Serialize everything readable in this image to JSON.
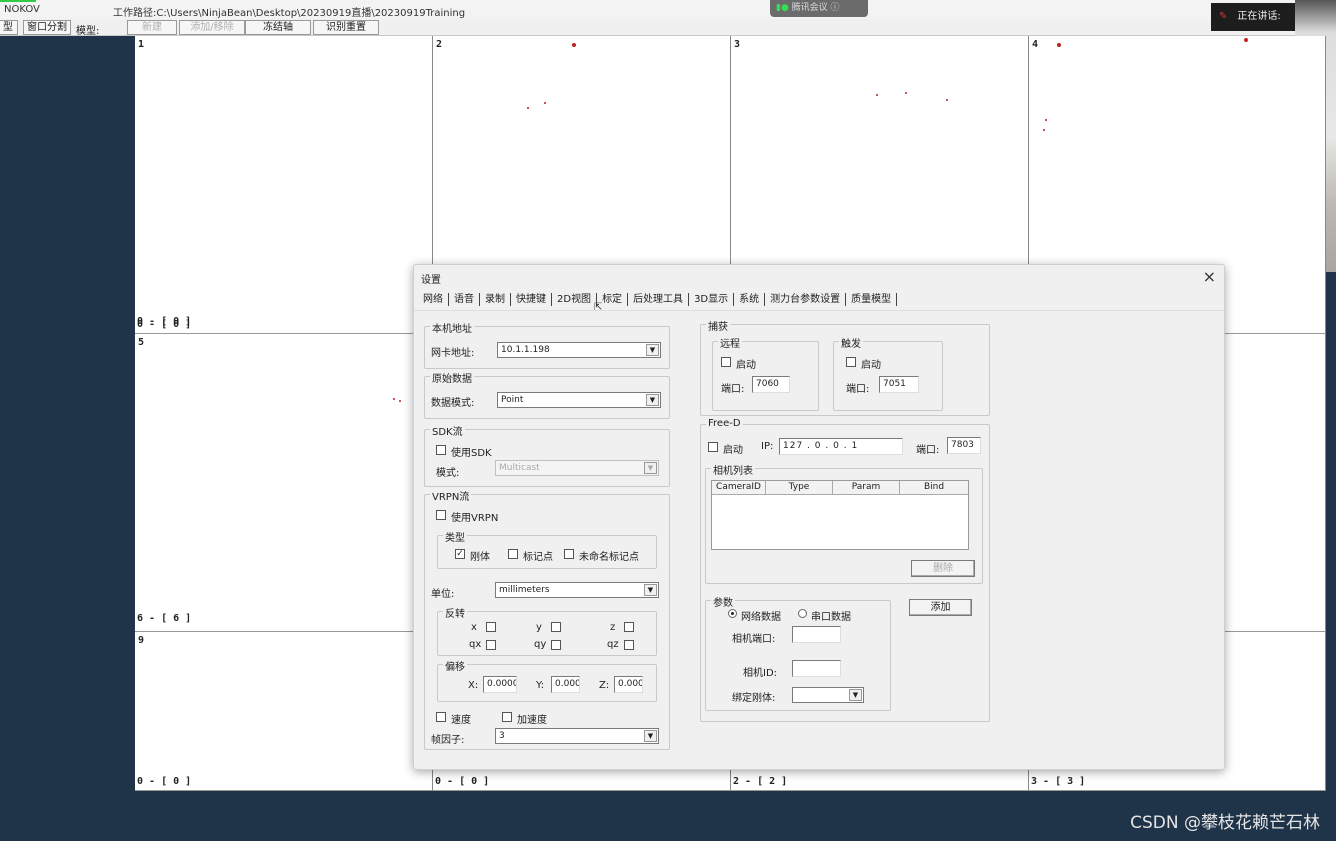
{
  "app": {
    "name": "NOKOV",
    "workpath": "工作路径:C:\\Users\\NinjaBean\\Desktop\\20230919直播\\20230919Training"
  },
  "toolbar": {
    "type_label": "型",
    "window_split": "窗口分割",
    "model_label": "模型:",
    "new_btn": "新建",
    "add_remove_btn": "添加/移除",
    "lock_axis_btn": "冻结轴",
    "recognize_reset_btn": "识别重置"
  },
  "meeting": {
    "label": "腾讯会议",
    "speaking": "正在讲话:"
  },
  "views": [
    {
      "num": "1",
      "footer": "0 - [ 0 ]"
    },
    {
      "num": "2",
      "footer": "0 - [ 0 ]"
    },
    {
      "num": "3",
      "footer": "2 - [ 2 ]"
    },
    {
      "num": "4",
      "footer": "3 - [ 3 ]"
    },
    {
      "num": "5",
      "footer": "0 - [ 0 ]"
    },
    {
      "num": "9",
      "footer": "6 - [ 6 ]"
    },
    {
      "num": "9",
      "footer": "0 - [ 0 ]"
    }
  ],
  "dialog": {
    "title": "设置",
    "close": "×",
    "tabs": [
      "网络",
      "语音",
      "录制",
      "快捷键",
      "2D视图",
      "标定",
      "后处理工具",
      "3D显示",
      "系统",
      "测力台参数设置",
      "质量模型"
    ],
    "local_address": {
      "legend": "本机地址",
      "nic_label": "网卡地址:",
      "nic_value": "10.1.1.198"
    },
    "raw_data": {
      "legend": "原始数据",
      "mode_label": "数据模式:",
      "mode_value": "Point"
    },
    "sdk": {
      "legend": "SDK流",
      "use_sdk": "使用SDK",
      "use_sdk_checked": false,
      "mode_label": "模式:",
      "mode_value": "Multicast"
    },
    "vrpn": {
      "legend": "VRPN流",
      "use_vrpn": "使用VRPN",
      "use_vrpn_checked": false,
      "type_legend": "类型",
      "rigid": "刚体",
      "rigid_checked": true,
      "marker": "标记点",
      "unnamed_marker": "未命名标记点",
      "unit_label": "单位:",
      "unit_value": "millimeters",
      "invert_legend": "反转",
      "axes": [
        "x",
        "y",
        "z",
        "qx",
        "qy",
        "qz"
      ],
      "offset_legend": "偏移",
      "offset_x_label": "X:",
      "offset_x": "0.0000",
      "offset_y_label": "Y:",
      "offset_y": "0.000",
      "offset_z_label": "Z:",
      "offset_z": "0.000",
      "velocity": "速度",
      "acceleration": "加速度",
      "frame_factor_label": "帧因子:",
      "frame_factor": "3"
    },
    "capture": {
      "legend": "捕获",
      "remote_legend": "远程",
      "remote_enable": "启动",
      "remote_port_label": "端口:",
      "remote_port": "7060",
      "trigger_legend": "触发",
      "trigger_enable": "启动",
      "trigger_port_label": "端口:",
      "trigger_port": "7051"
    },
    "freed": {
      "legend": "Free-D",
      "enable": "启动",
      "ip_label": "IP:",
      "ip": [
        "127",
        "0",
        "0",
        "1"
      ],
      "port_label": "端口:",
      "port": "7803",
      "camera_list_legend": "相机列表",
      "columns": [
        "CameraID",
        "Type",
        "Param",
        "Bind"
      ],
      "delete_btn": "删除",
      "params_legend": "参数",
      "net_data": "网络数据",
      "serial_data": "串口数据",
      "camera_port_label": "相机端口:",
      "camera_id_label": "相机ID:",
      "bind_rigid_label": "绑定刚体:",
      "add_btn": "添加"
    }
  },
  "watermark": "CSDN @攀枝花赖芒石林"
}
